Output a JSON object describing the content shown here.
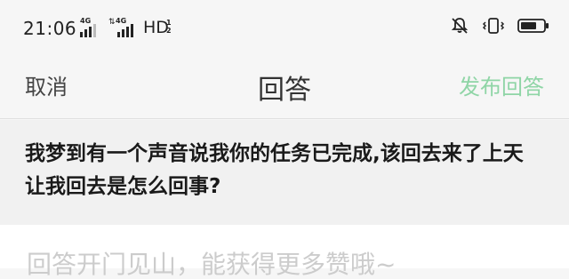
{
  "status_bar": {
    "time": "21:06",
    "network1": "4G",
    "network2": "4G",
    "hd": "HD",
    "hd_sub": "1\n2"
  },
  "header": {
    "cancel_label": "取消",
    "title": "回答",
    "publish_label": "发布回答",
    "publish_color": "#8fd5a6"
  },
  "question": {
    "text": "我梦到有一个声音说我你的任务已完成,该回去来了上天让我回去是怎么回事?"
  },
  "answer": {
    "placeholder": "回答开门见山，能获得更多赞哦~"
  },
  "icons": [
    "signal-icon",
    "mute-icon",
    "vibrate-icon",
    "battery-icon"
  ]
}
